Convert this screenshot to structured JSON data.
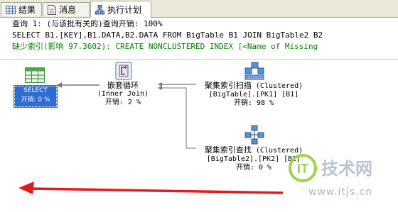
{
  "tabs": [
    {
      "label": "结果",
      "icon": "grid-icon"
    },
    {
      "label": "消息",
      "icon": "message-icon"
    },
    {
      "label": "执行计划",
      "icon": "execution-plan-icon"
    }
  ],
  "header": {
    "line1": "查询 1: (与该批有关的)查询开销: 100%",
    "line2": "SELECT B1.[KEY],B1.DATA,B2.DATA FROM BigTable B1 JOIN BigTable2 B2",
    "line3": "缺少索引(影响 97.3602): CREATE NONCLUSTERED INDEX [<Name of Missing"
  },
  "nodes": {
    "select": {
      "label": "SELECT",
      "cost": "开销: 0 %"
    },
    "loop": {
      "name": "嵌套循环",
      "sub": "(Inner Join)",
      "cost": "开销: 2 %"
    },
    "scan": {
      "name": "聚集索引扫描",
      "suffix": "(Clustered)",
      "sub": "[BigTable].[PK1] [B1]",
      "cost": "开销: 98 %"
    },
    "seek": {
      "name": "聚集索引查找",
      "suffix": "(Clustered)",
      "sub": "[BigTable2].[PK2] [B2]",
      "cost": "开销: 0 %"
    }
  },
  "watermark": {
    "brand": "IT技术网",
    "url": "www.itjs.cn"
  },
  "colors": {
    "arrow": "#e8191b",
    "selected": "#2d6cd1",
    "missing_index": "#008000"
  }
}
